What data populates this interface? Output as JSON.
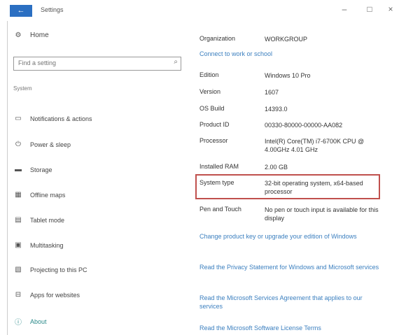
{
  "window": {
    "title": "Settings",
    "back_glyph": "←",
    "controls": {
      "minimize": "–",
      "maximize": "□",
      "close": "×"
    }
  },
  "sidebar": {
    "home": {
      "label": "Home",
      "icon": "gear-icon",
      "glyph": "⚙"
    },
    "search": {
      "placeholder": "Find a setting",
      "icon": "search-icon",
      "glyph": "⌕"
    },
    "section_label": "System",
    "items": [
      {
        "label": "Notifications & actions",
        "icon": "notifications-icon",
        "glyph": "▭"
      },
      {
        "label": "Power & sleep",
        "icon": "power-icon",
        "glyph": "⏻"
      },
      {
        "label": "Storage",
        "icon": "storage-icon",
        "glyph": "▬"
      },
      {
        "label": "Offline maps",
        "icon": "map-icon",
        "glyph": "▦"
      },
      {
        "label": "Tablet mode",
        "icon": "tablet-icon",
        "glyph": "▤"
      },
      {
        "label": "Multitasking",
        "icon": "multitasking-icon",
        "glyph": "▣"
      },
      {
        "label": "Projecting to this PC",
        "icon": "projecting-icon",
        "glyph": "▧"
      },
      {
        "label": "Apps for websites",
        "icon": "apps-websites-icon",
        "glyph": "⊟"
      },
      {
        "label": "About",
        "icon": "about-icon",
        "glyph": "ⓘ",
        "active": true
      }
    ]
  },
  "about": {
    "organization": {
      "label": "Organization",
      "value": "WORKGROUP"
    },
    "connect_link": "Connect to work or school",
    "specs": [
      {
        "label": "Edition",
        "value": "Windows 10 Pro"
      },
      {
        "label": "Version",
        "value": "1607"
      },
      {
        "label": "OS Build",
        "value": "14393.0"
      },
      {
        "label": "Product ID",
        "value": "00330-80000-00000-AA082"
      },
      {
        "label": "Processor",
        "value": "Intel(R) Core(TM) i7-6700K CPU @ 4.00GHz   4.01 GHz"
      },
      {
        "label": "Installed RAM",
        "value": "2.00 GB"
      },
      {
        "label": "System type",
        "value": "32-bit operating system, x64-based processor"
      },
      {
        "label": "Pen and Touch",
        "value": "No pen or touch input is available for this display"
      }
    ],
    "links": [
      "Change product key or upgrade your edition of Windows",
      "Read the Privacy Statement for Windows and Microsoft services",
      "Read the Microsoft Services Agreement that applies to our services",
      "Read the Microsoft Software License Terms"
    ]
  },
  "colors": {
    "accent": "#2b6fc2",
    "link": "#3b7fbf",
    "highlight_border": "#c0504d",
    "active_nav": "#2b8a8a"
  }
}
